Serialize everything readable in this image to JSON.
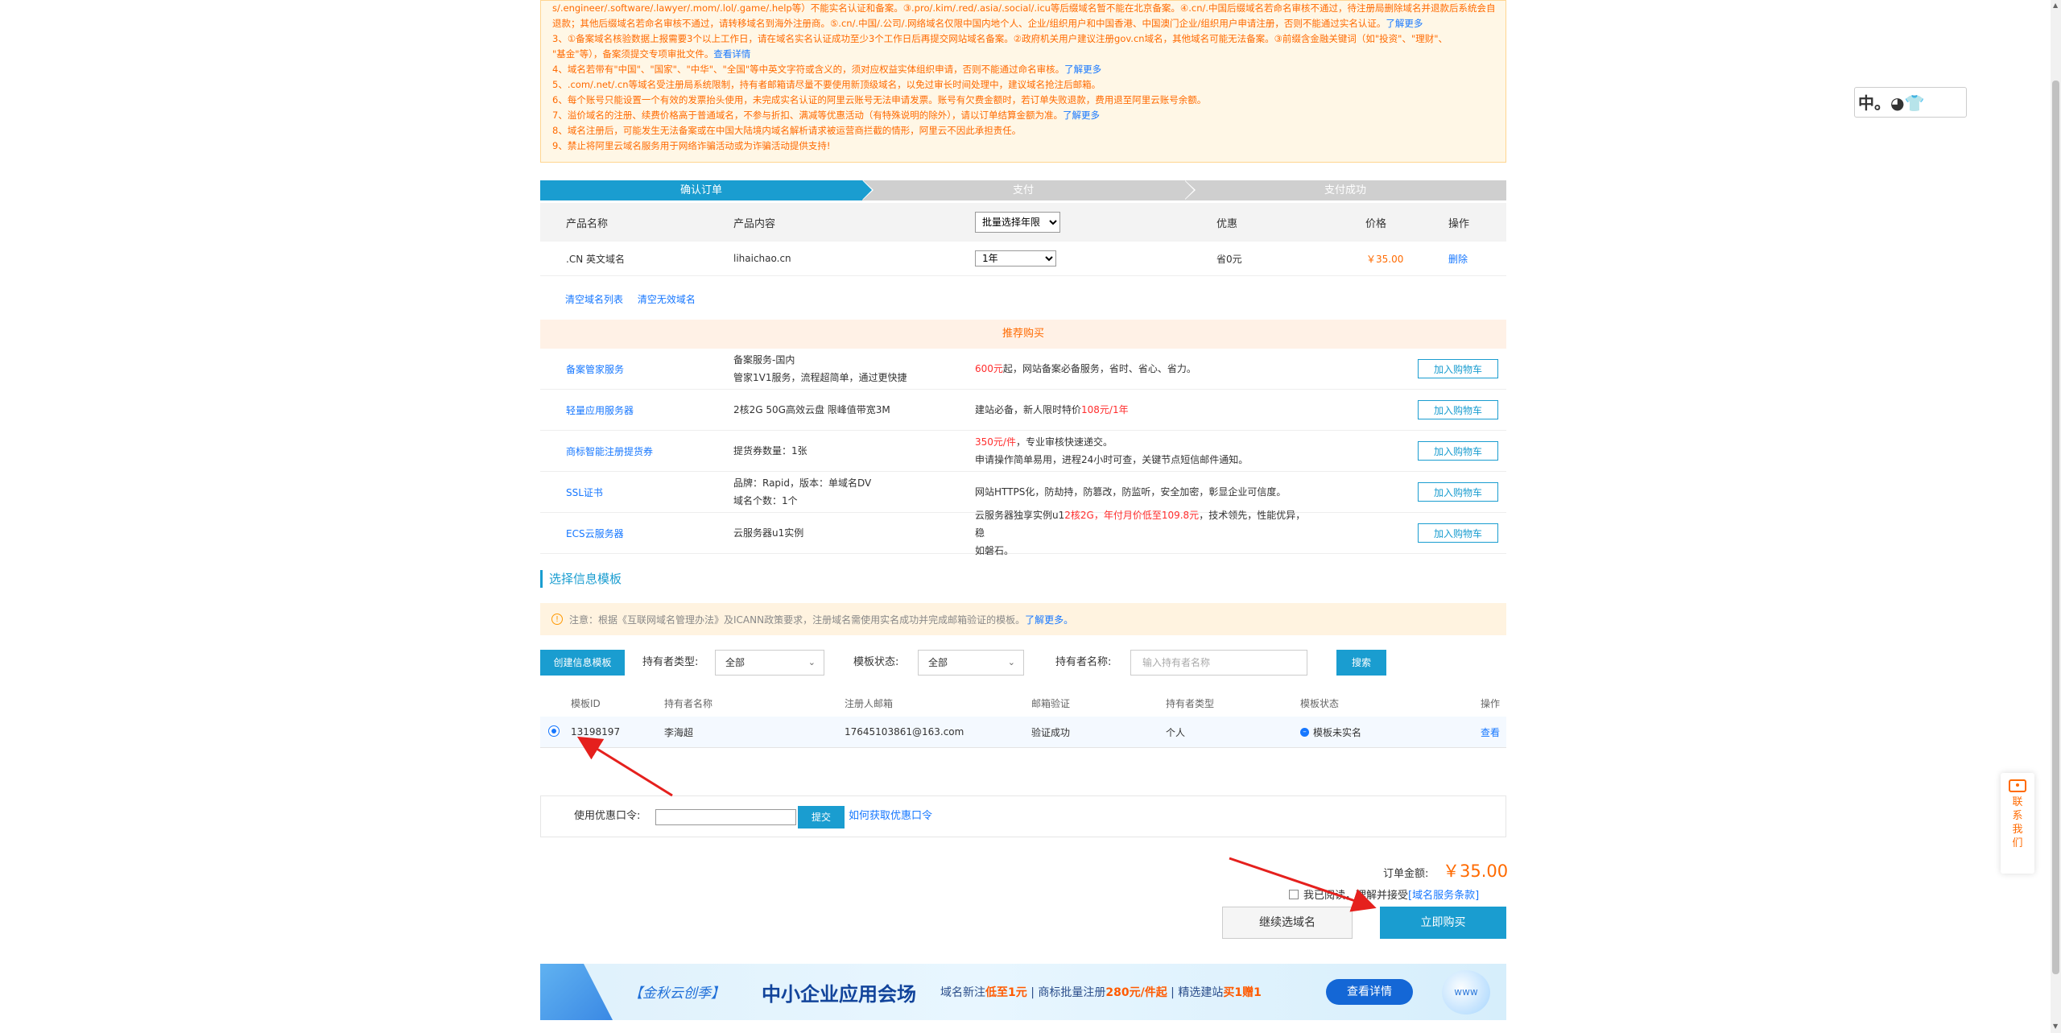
{
  "notice": {
    "lines": [
      "s/.engineer/.software/.lawyer/.mom/.lol/.game/.help等）不能实名认证和备案。③.pro/.kim/.red/.asia/.social/.icu等后缀域名暂不能在北京备案。④.cn/.中国后缀域名若命名审核不通过，待注册局删除域名并退款后系统会自动",
      "退款；其他后缀域名若命名审核不通过，请转移域名到海外注册商。⑤.cn/.中国/.公司/.网络域名仅限中国内地个人、企业/组织用户和中国香港、中国澳门企业/组织用户申请注册，否则不能通过实名认证。",
      "3、①备案域名核验数据上报需要3个以上工作日，请在域名实名认证成功至少3个工作日后再提交网站域名备案。②政府机关用户建议注册gov.cn域名，其他域名可能无法备案。③前缀含金融关键词（如\"投资\"、\"理财\"、",
      "\"基金\"等），备案须提交专项审批文件。",
      "4、域名若带有\"中国\"、\"国家\"、\"中华\"、\"全国\"等中英文字符或含义的，须对应权益实体组织申请，否则不能通过命名审核。",
      "5、.com/.net/.cn等域名受注册局系统限制，持有者邮箱请尽量不要使用新顶级域名，以免过审长时间处理中，建议域名抢注后邮箱。",
      "6、每个账号只能设置一个有效的发票抬头使用，未完成实名认证的阿里云账号无法申请发票。账号有欠费金额时，若订单失败退款，费用退至阿里云账号余额。",
      "7、溢价域名的注册、续费价格高于普通域名，不参与折扣、满减等优惠活动（有特殊说明的除外），请以订单结算金额为准。",
      "8、域名注册后，可能发生无法备案或在中国大陆境内域名解析请求被运营商拦截的情形，阿里云不因此承担责任。",
      "9、禁止将阿里云域名服务用于网络诈骗活动或为诈骗活动提供支持!"
    ],
    "link_more": "了解更多",
    "link_detail": "查看详情"
  },
  "steps": [
    "确认订单",
    "支付",
    "支付成功"
  ],
  "order": {
    "headers": {
      "name": "产品名称",
      "content": "产品内容",
      "period_select": "批量选择年限",
      "discount": "优惠",
      "price": "价格",
      "action": "操作"
    },
    "row": {
      "name": ".CN 英文域名",
      "content": "lihaichao.cn",
      "period": "1年",
      "discount": "省0元",
      "price": "￥35.00",
      "action": "删除"
    },
    "clear_list": "清空域名列表",
    "clear_invalid": "清空无效域名"
  },
  "recommend": {
    "title": "推荐购买",
    "button_label": "加入购物车",
    "rows": [
      {
        "name": "备案管家服务",
        "content": [
          "备案服务-国内",
          "管家1V1服务，流程超简单，通过更快捷"
        ],
        "desc_red": "600元",
        "desc": "起，网站备案必备服务，省时、省心、省力。"
      },
      {
        "name": "轻量应用服务器",
        "content": [
          "2核2G 50G高效云盘 限峰值带宽3M"
        ],
        "desc": "建站必备，新人限时特价",
        "desc_red": "108元/1年"
      },
      {
        "name": "商标智能注册提货券",
        "content": [
          "提货券数量：1张"
        ],
        "desc_red": "350元/件",
        "desc": "，专业审核快速递交。",
        "desc2": "申请操作简单易用，进程24小时可查，关键节点短信邮件通知。"
      },
      {
        "name": "SSL证书",
        "content": [
          "品牌：Rapid，版本：单域名DV",
          "域名个数：1个"
        ],
        "desc": "网站HTTPS化，防劫持，防篡改，防监听，安全加密，彰显企业可信度。"
      },
      {
        "name": "ECS云服务器",
        "content": [
          "云服务器u1实例"
        ],
        "desc": "云服务器独享实例u1",
        "desc_red": "2核2G，年付月价低至109.8元",
        "desc_tail": "，技术领先，性能优异，稳",
        "desc2": "如磐石。"
      }
    ]
  },
  "template": {
    "section_title": "选择信息模板",
    "warning": "注意：根据《互联网域名管理办法》及ICANN政策要求，注册域名需使用实名成功并完成邮箱验证的模板。",
    "warning_link": "了解更多。",
    "create_button": "创建信息模板",
    "holder_type_label": "持有者类型:",
    "holder_type_value": "全部",
    "status_label": "模板状态:",
    "status_value": "全部",
    "holder_name_label": "持有者名称:",
    "holder_name_placeholder": "输入持有者名称",
    "search_button": "搜索",
    "headers": {
      "id": "模板ID",
      "holder": "持有者名称",
      "email": "注册人邮箱",
      "email_verify": "邮箱验证",
      "holder_type": "持有者类型",
      "status": "模板状态",
      "action": "操作"
    },
    "row": {
      "id": "13198197",
      "holder": "李海超",
      "email": "17645103861@163.com",
      "email_verify": "验证成功",
      "holder_type": "个人",
      "status": "模板未实名",
      "action": "查看"
    }
  },
  "coupon": {
    "label": "使用优惠口令:",
    "submit": "提交",
    "how_to": "如何获取优惠口令"
  },
  "checkout": {
    "total_label": "订单金额:",
    "total_value": "￥35.00",
    "agree_prefix": "我已阅读，理解并接受",
    "terms_link": "[域名服务条款]",
    "continue_button": "继续选域名",
    "buy_button": "立即购买"
  },
  "banner": {
    "tag": "【金秋云创季】",
    "main": "中小企业应用会场",
    "sub_a": "域名新注",
    "sub_a_red": "低至1元",
    "sub_b": " | 商标批量注册",
    "sub_b_red": "280元/件起",
    "sub_c": " | 精选建站",
    "sub_c_red": "买1赠1",
    "more": "查看详情"
  },
  "side_contact": {
    "label": "联系我们"
  },
  "ime": {
    "text": "中。◕👕"
  },
  "colors": {
    "accent": "#1a9dd0",
    "price": "#ff6a00",
    "link": "#1677ff",
    "arrow": "#e5201d"
  }
}
